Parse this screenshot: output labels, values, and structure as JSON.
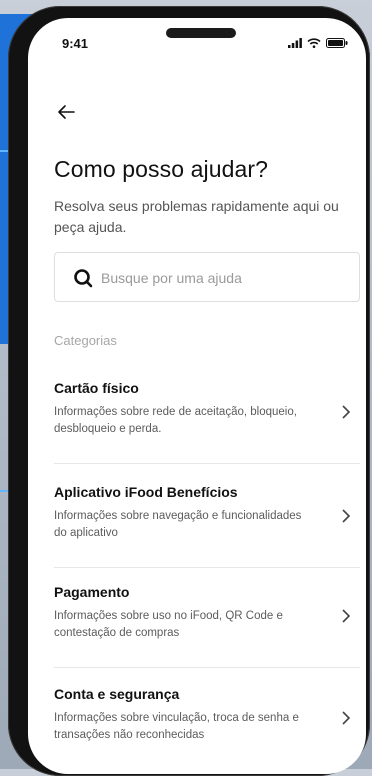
{
  "status_bar": {
    "time": "9:41"
  },
  "header": {
    "title": "Como posso ajudar?",
    "subtitle": "Resolva seus problemas rapidamente aqui ou peça ajuda."
  },
  "search": {
    "placeholder": "Busque por uma ajuda"
  },
  "categories": {
    "label": "Categorias",
    "items": [
      {
        "title": "Cartão físico",
        "description": "Informações sobre rede de aceitação, bloqueio, desbloqueio e perda."
      },
      {
        "title": "Aplicativo iFood Benefícios",
        "description": "Informações sobre navegação e funcionalidades do aplicativo"
      },
      {
        "title": "Pagamento",
        "description": "Informações sobre uso no iFood, QR Code e contestação de compras"
      },
      {
        "title": "Conta e segurança",
        "description": "Informações sobre vinculação, troca de senha e transações não reconhecidas"
      }
    ]
  },
  "colors": {
    "accent_blue": "#1f73d8",
    "phone_frame": "#121212"
  }
}
